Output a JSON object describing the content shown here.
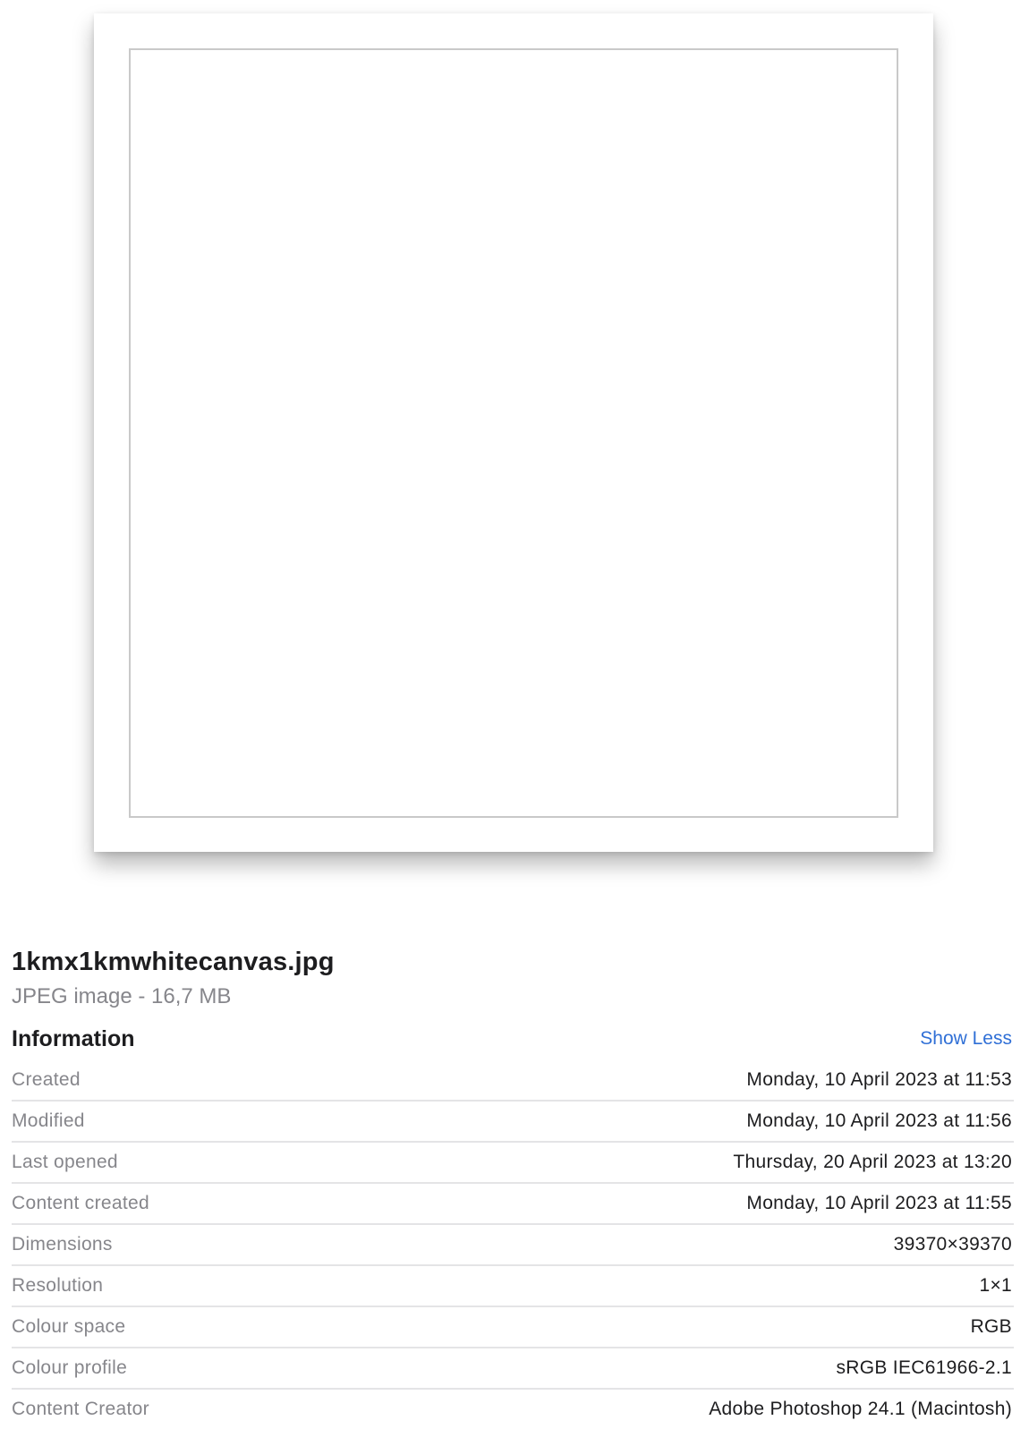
{
  "file": {
    "name": "1kmx1kmwhitecanvas.jpg",
    "kind": "JPEG image - 16,7 MB"
  },
  "info": {
    "title": "Information",
    "toggle_label": "Show Less",
    "rows": [
      {
        "label": "Created",
        "value": "Monday, 10 April 2023 at 11:53"
      },
      {
        "label": "Modified",
        "value": "Monday, 10 April 2023 at 11:56"
      },
      {
        "label": "Last opened",
        "value": "Thursday, 20 April 2023 at 13:20"
      },
      {
        "label": "Content created",
        "value": "Monday, 10 April 2023 at 11:55"
      },
      {
        "label": "Dimensions",
        "value": "39370×39370"
      },
      {
        "label": "Resolution",
        "value": "1×1"
      },
      {
        "label": "Colour space",
        "value": "RGB"
      },
      {
        "label": "Colour profile",
        "value": "sRGB IEC61966-2.1"
      },
      {
        "label": "Content Creator",
        "value": "Adobe Photoshop 24.1 (Macintosh)"
      }
    ]
  },
  "colors": {
    "link": "#2f6fd6",
    "secondary_text": "#86868b",
    "primary_text": "#1d1d1f"
  }
}
